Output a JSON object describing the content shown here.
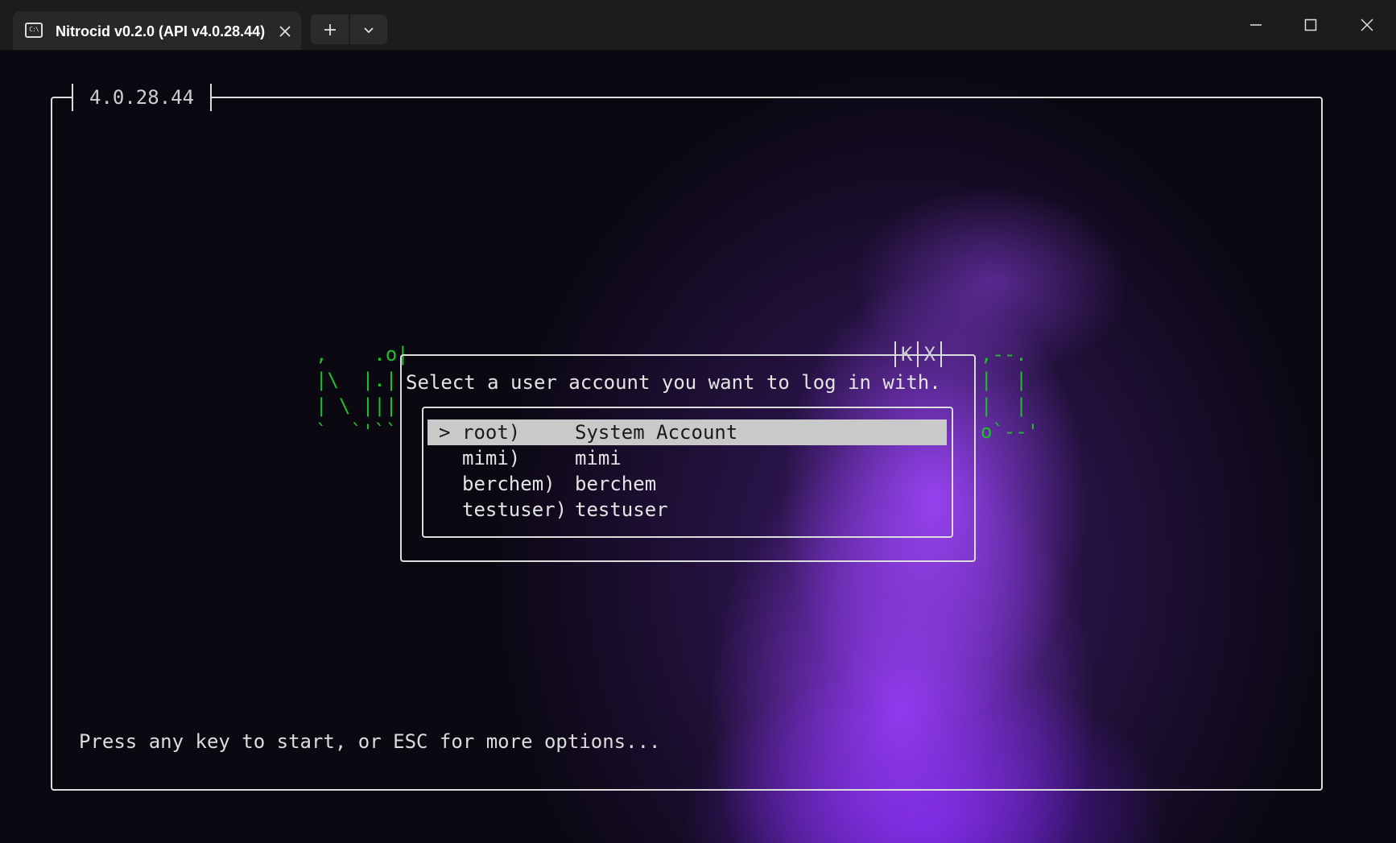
{
  "window": {
    "tab_title": "Nitrocid v0.2.0 (API v4.0.28.44)",
    "tab_icon": "console-icon"
  },
  "terminal": {
    "frame_title": "4.0.28.44",
    "ascii_left": ",    .o|\n|\\  |.|\n| \\ |||\n`  `'``",
    "ascii_right": ",--.\n|  |\n|  |\no`--'",
    "dialog": {
      "prompt": "Select a user account you want to log in with.",
      "buttons": [
        "K",
        "X"
      ],
      "users": [
        {
          "marker": ">",
          "key": "root)",
          "name": "System Account",
          "selected": true
        },
        {
          "marker": "",
          "key": "mimi)",
          "name": "mimi",
          "selected": false
        },
        {
          "marker": "",
          "key": "berchem)",
          "name": "berchem",
          "selected": false
        },
        {
          "marker": "",
          "key": "testuser)",
          "name": "testuser",
          "selected": false
        }
      ]
    },
    "footer": "Press any key to start, or ESC for more options..."
  },
  "colors": {
    "ascii_green": "#1fbf2a",
    "selection_bg": "#c9c9c9",
    "accent_purple": "#9a44f5"
  }
}
